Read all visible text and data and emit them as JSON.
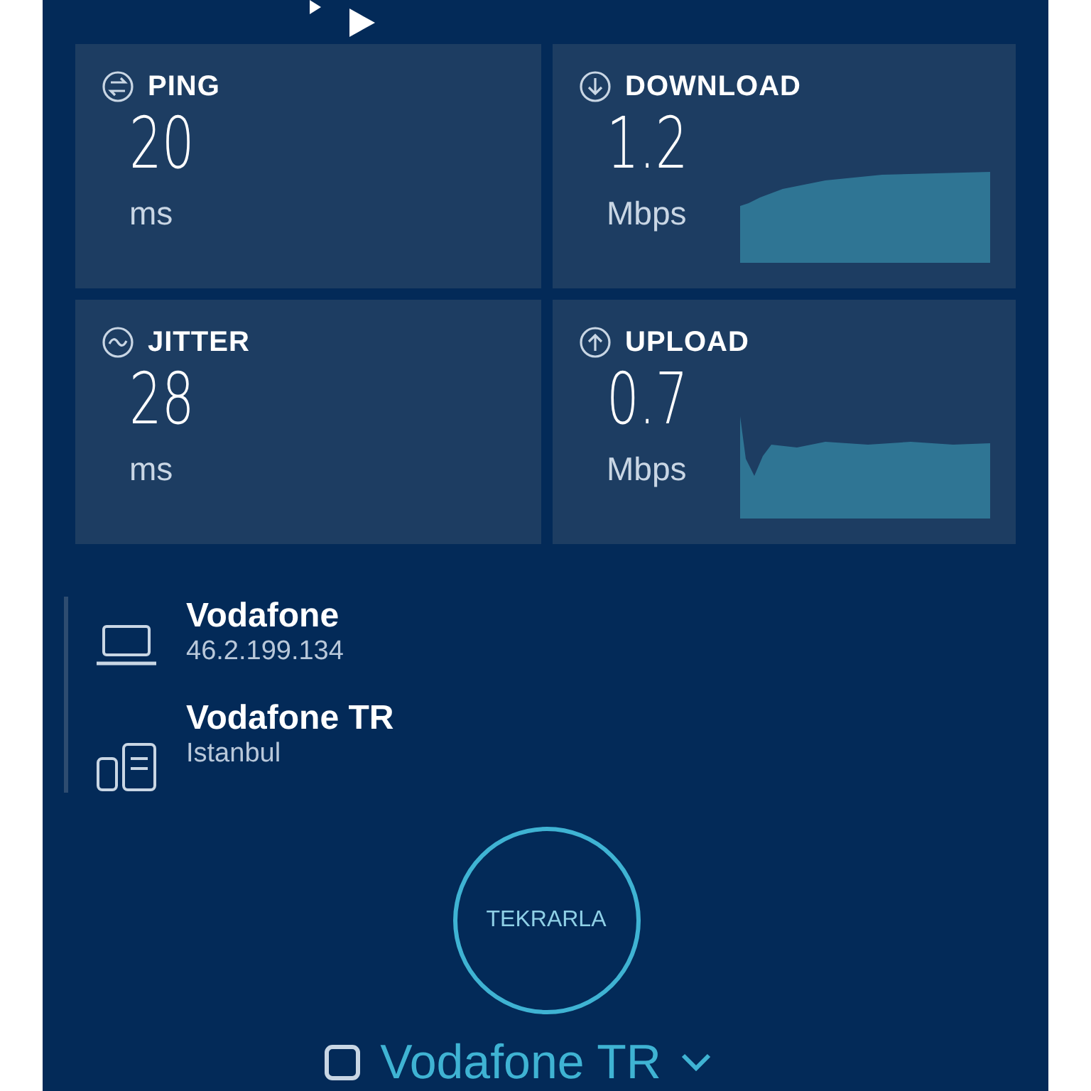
{
  "metrics": [
    {
      "kind": "ping",
      "label": "PING",
      "value": "20",
      "unit": "ms"
    },
    {
      "kind": "download",
      "label": "DOWNLOAD",
      "value": "1.2",
      "unit": "Mbps"
    },
    {
      "kind": "jitter",
      "label": "JITTER",
      "value": "28",
      "unit": "ms"
    },
    {
      "kind": "upload",
      "label": "UPLOAD",
      "value": "0.7",
      "unit": "Mbps"
    }
  ],
  "connection": {
    "isp": "Vodafone",
    "ip": "46.2.199.134"
  },
  "server": {
    "name": "Vodafone TR",
    "location": "Istanbul"
  },
  "retry_button": "TEKRARLA",
  "server_selector": "Vodafone TR"
}
